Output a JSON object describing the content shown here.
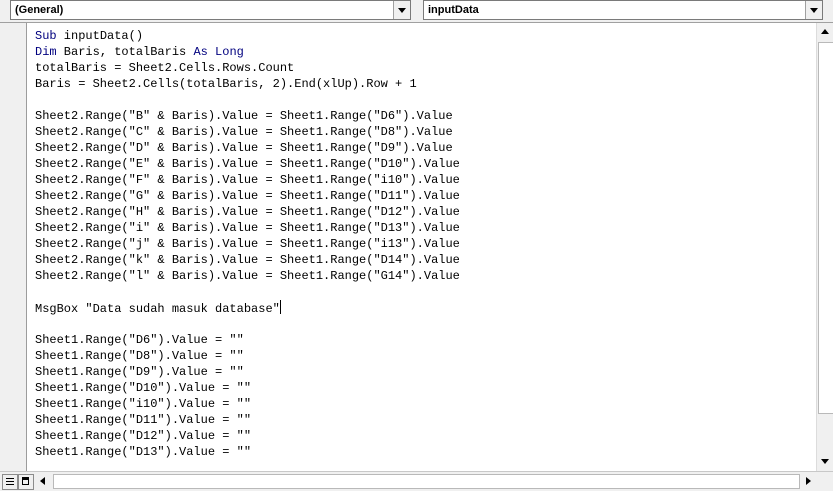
{
  "header": {
    "object_combo": "(General)",
    "procedure_combo": "inputData"
  },
  "code_lines": [
    [
      {
        "t": "Sub",
        "k": true
      },
      {
        "t": " inputData()"
      }
    ],
    [
      {
        "t": "Dim",
        "k": true
      },
      {
        "t": " Baris, totalBaris "
      },
      {
        "t": "As",
        "k": true
      },
      {
        "t": " "
      },
      {
        "t": "Long",
        "k": true
      }
    ],
    [
      {
        "t": "totalBaris = Sheet2.Cells.Rows.Count"
      }
    ],
    [
      {
        "t": "Baris = Sheet2.Cells(totalBaris, 2).End(xlUp).Row + 1"
      }
    ],
    [],
    [
      {
        "t": "Sheet2.Range(\"B\" & Baris).Value = Sheet1.Range(\"D6\").Value"
      }
    ],
    [
      {
        "t": "Sheet2.Range(\"C\" & Baris).Value = Sheet1.Range(\"D8\").Value"
      }
    ],
    [
      {
        "t": "Sheet2.Range(\"D\" & Baris).Value = Sheet1.Range(\"D9\").Value"
      }
    ],
    [
      {
        "t": "Sheet2.Range(\"E\" & Baris).Value = Sheet1.Range(\"D10\").Value"
      }
    ],
    [
      {
        "t": "Sheet2.Range(\"F\" & Baris).Value = Sheet1.Range(\"i10\").Value"
      }
    ],
    [
      {
        "t": "Sheet2.Range(\"G\" & Baris).Value = Sheet1.Range(\"D11\").Value"
      }
    ],
    [
      {
        "t": "Sheet2.Range(\"H\" & Baris).Value = Sheet1.Range(\"D12\").Value"
      }
    ],
    [
      {
        "t": "Sheet2.Range(\"i\" & Baris).Value = Sheet1.Range(\"D13\").Value"
      }
    ],
    [
      {
        "t": "Sheet2.Range(\"j\" & Baris).Value = Sheet1.Range(\"i13\").Value"
      }
    ],
    [
      {
        "t": "Sheet2.Range(\"k\" & Baris).Value = Sheet1.Range(\"D14\").Value"
      }
    ],
    [
      {
        "t": "Sheet2.Range(\"l\" & Baris).Value = Sheet1.Range(\"G14\").Value"
      }
    ],
    [],
    [
      {
        "t": "MsgBox \"Data sudah masuk database\""
      }
    ],
    [],
    [
      {
        "t": "Sheet1.Range(\"D6\").Value = \"\""
      }
    ],
    [
      {
        "t": "Sheet1.Range(\"D8\").Value = \"\""
      }
    ],
    [
      {
        "t": "Sheet1.Range(\"D9\").Value = \"\""
      }
    ],
    [
      {
        "t": "Sheet1.Range(\"D10\").Value = \"\""
      }
    ],
    [
      {
        "t": "Sheet1.Range(\"i10\").Value = \"\""
      }
    ],
    [
      {
        "t": "Sheet1.Range(\"D11\").Value = \"\""
      }
    ],
    [
      {
        "t": "Sheet1.Range(\"D12\").Value = \"\""
      }
    ],
    [
      {
        "t": "Sheet1.Range(\"D13\").Value = \"\""
      }
    ]
  ],
  "caret_line": 17,
  "colors": {
    "keyword": "#00007f",
    "text": "#000000",
    "editor_bg": "#ffffff",
    "chrome_bg": "#f0f0f0"
  },
  "icons": {
    "object_dropdown": "chevron-down-icon",
    "procedure_dropdown": "chevron-down-icon",
    "scroll_up": "arrow-up-icon",
    "scroll_down": "arrow-down-icon",
    "scroll_left": "arrow-left-icon",
    "scroll_right": "arrow-right-icon",
    "procedure_view": "procedure-view-icon",
    "full_module_view": "full-module-view-icon"
  }
}
